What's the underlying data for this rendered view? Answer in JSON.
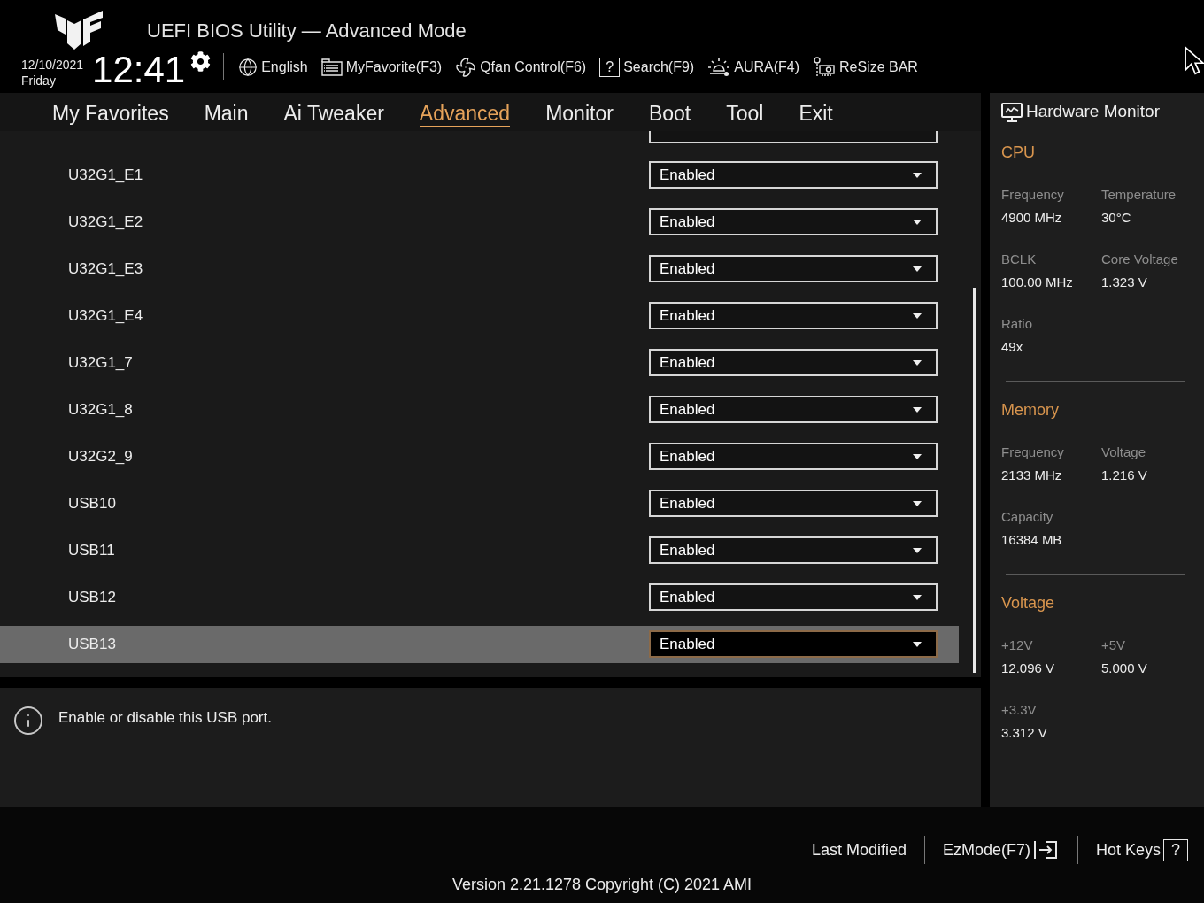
{
  "header": {
    "title": "UEFI BIOS Utility — Advanced Mode",
    "date": "12/10/2021",
    "day": "Friday",
    "time": "12:41"
  },
  "toolbar": [
    {
      "kind": "language",
      "label": "English"
    },
    {
      "kind": "favorites",
      "label": "MyFavorite(F3)"
    },
    {
      "kind": "fan",
      "label": "Qfan Control(F6)"
    },
    {
      "kind": "search",
      "label": "Search(F9)",
      "glyph": "?"
    },
    {
      "kind": "aura",
      "label": "AURA(F4)"
    },
    {
      "kind": "resize",
      "label": "ReSize BAR"
    }
  ],
  "tabs": [
    {
      "label": "My Favorites",
      "selected": false
    },
    {
      "label": "Main",
      "selected": false
    },
    {
      "label": "Ai Tweaker",
      "selected": false
    },
    {
      "label": "Advanced",
      "selected": true
    },
    {
      "label": "Monitor",
      "selected": false
    },
    {
      "label": "Boot",
      "selected": false
    },
    {
      "label": "Tool",
      "selected": false
    },
    {
      "label": "Exit",
      "selected": false
    }
  ],
  "settings": {
    "clipped_row_above": true,
    "rows": [
      {
        "label": "U32G1_E1",
        "value": "Enabled",
        "selected": false
      },
      {
        "label": "U32G1_E2",
        "value": "Enabled",
        "selected": false
      },
      {
        "label": "U32G1_E3",
        "value": "Enabled",
        "selected": false
      },
      {
        "label": "U32G1_E4",
        "value": "Enabled",
        "selected": false
      },
      {
        "label": "U32G1_7",
        "value": "Enabled",
        "selected": false
      },
      {
        "label": "U32G1_8",
        "value": "Enabled",
        "selected": false
      },
      {
        "label": "U32G2_9",
        "value": "Enabled",
        "selected": false
      },
      {
        "label": "USB10",
        "value": "Enabled",
        "selected": false
      },
      {
        "label": "USB11",
        "value": "Enabled",
        "selected": false
      },
      {
        "label": "USB12",
        "value": "Enabled",
        "selected": false
      },
      {
        "label": "USB13",
        "value": "Enabled",
        "selected": true
      }
    ]
  },
  "help": {
    "text": "Enable or disable this USB port."
  },
  "hardware_monitor": {
    "title": "Hardware Monitor",
    "sections": [
      {
        "title": "CPU",
        "items": [
          {
            "label": "Frequency",
            "value": "4900 MHz"
          },
          {
            "label": "Temperature",
            "value": "30°C"
          },
          {
            "label": "BCLK",
            "value": "100.00 MHz"
          },
          {
            "label": "Core Voltage",
            "value": "1.323 V"
          },
          {
            "label": "Ratio",
            "value": "49x"
          }
        ]
      },
      {
        "title": "Memory",
        "items": [
          {
            "label": "Frequency",
            "value": "2133 MHz"
          },
          {
            "label": "Voltage",
            "value": "1.216 V"
          },
          {
            "label": "Capacity",
            "value": "16384 MB"
          }
        ]
      },
      {
        "title": "Voltage",
        "items": [
          {
            "label": "+12V",
            "value": "12.096 V"
          },
          {
            "label": "+5V",
            "value": "5.000 V"
          },
          {
            "label": "+3.3V",
            "value": "3.312 V"
          }
        ]
      }
    ]
  },
  "footer": {
    "actions": [
      {
        "kind": "text",
        "label": "Last Modified"
      },
      {
        "kind": "exit",
        "label": "EzMode(F7)"
      },
      {
        "kind": "help",
        "label": "Hot Keys",
        "glyph": "?"
      }
    ],
    "version": "Version 2.21.1278 Copyright (C) 2021 AMI"
  }
}
